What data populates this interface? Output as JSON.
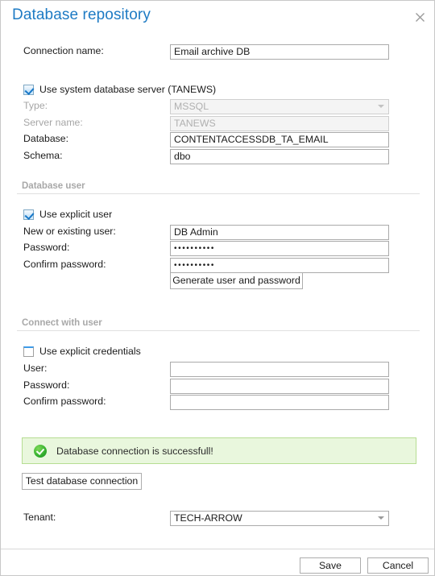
{
  "dialog": {
    "title": "Database repository",
    "close_icon": "close-icon"
  },
  "connection": {
    "label": "Connection name:",
    "value": "Email archive DB"
  },
  "system_server": {
    "checkbox_label": "Use system database server (TANEWS)",
    "checked": true,
    "fields": [
      {
        "label": "Type:",
        "value": "MSSQL",
        "disabled": true,
        "type": "select"
      },
      {
        "label": "Server name:",
        "value": "TANEWS",
        "disabled": true,
        "type": "text"
      },
      {
        "label": "Database:",
        "value": "CONTENTACCESSDB_TA_EMAIL",
        "disabled": false,
        "type": "text"
      },
      {
        "label": "Schema:",
        "value": "dbo",
        "disabled": false,
        "type": "text"
      }
    ]
  },
  "database_user": {
    "section_title": "Database user",
    "checkbox_label": "Use explicit user",
    "checked": true,
    "user_label": "New or existing user:",
    "user_value": "DB Admin",
    "password_label": "Password:",
    "password_value": "••••••••••",
    "confirm_label": "Confirm password:",
    "confirm_value": "••••••••••",
    "generate_button": "Generate user and password"
  },
  "connect_with_user": {
    "section_title": "Connect with user",
    "checkbox_label": "Use explicit credentials",
    "checked": false,
    "user_label": "User:",
    "user_value": "",
    "password_label": "Password:",
    "password_value": "",
    "confirm_label": "Confirm password:",
    "confirm_value": ""
  },
  "status": {
    "message": "Database connection is successfull!",
    "icon": "success-check-icon",
    "background_color": "#e9f7dd",
    "border_color": "#b6dd92",
    "icon_color": "#33af2e"
  },
  "test_button": {
    "label": "Test database connection"
  },
  "tenant": {
    "label": "Tenant:",
    "value": "TECH-ARROW"
  },
  "footer": {
    "save_label": "Save",
    "cancel_label": "Cancel"
  },
  "theme": {
    "title_color": "#1e7bc4",
    "accent": "#1878c8"
  }
}
